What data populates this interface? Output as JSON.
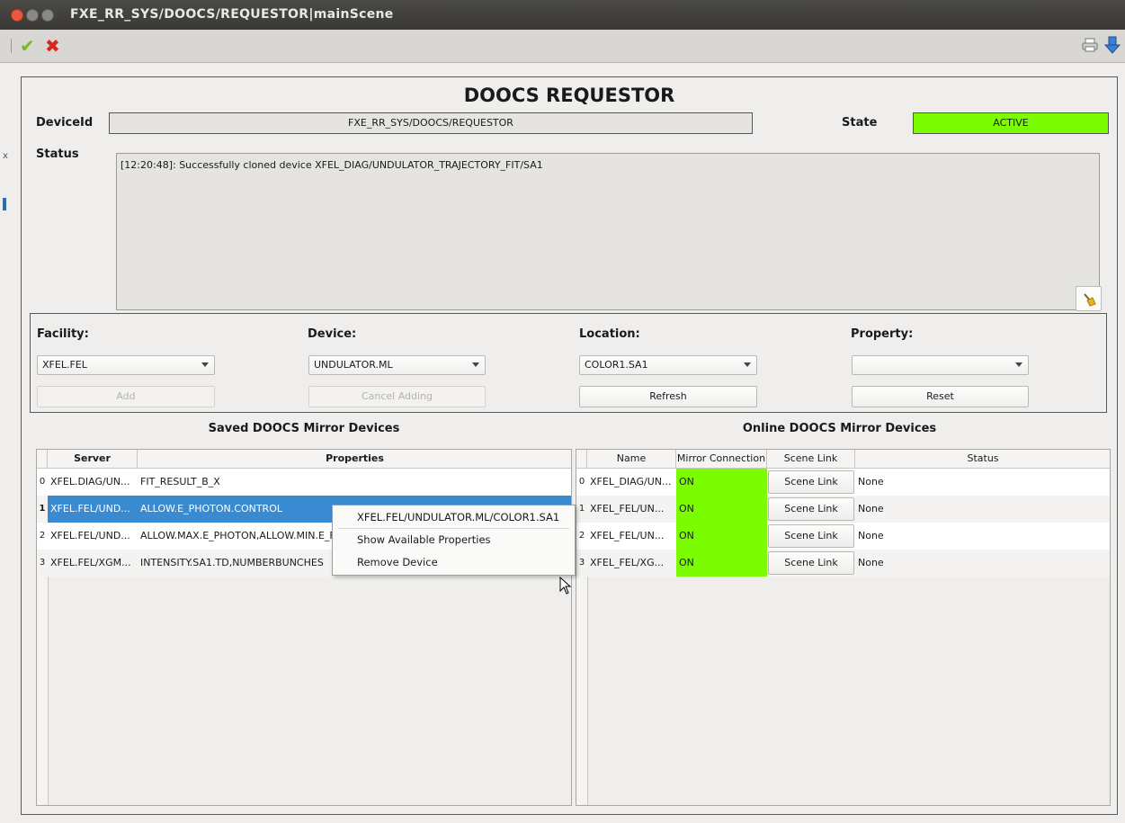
{
  "window": {
    "title": "FXE_RR_SYS/DOOCS/REQUESTOR|mainScene"
  },
  "toolbar": {
    "apply_icon": "checkmark-icon",
    "cancel_icon": "red-x-icon",
    "print_icon": "printer-icon",
    "download_icon": "blue-down-arrow-icon"
  },
  "scene": {
    "heading": "DOOCS REQUESTOR",
    "device_id_label": "DeviceId",
    "device_id_value": "FXE_RR_SYS/DOOCS/REQUESTOR",
    "state_label": "State",
    "state_value": "ACTIVE",
    "status_label": "Status",
    "status_text": "[12:20:48]: Successfully cloned device XFEL_DIAG/UNDULATOR_TRAJECTORY_FIT/SA1"
  },
  "selectors": {
    "facility": {
      "label": "Facility:",
      "value": "XFEL.FEL",
      "button": "Add"
    },
    "device": {
      "label": "Device:",
      "value": "UNDULATOR.ML",
      "button": "Cancel Adding"
    },
    "location": {
      "label": "Location:",
      "value": "COLOR1.SA1",
      "button": "Refresh"
    },
    "property": {
      "label": "Property:",
      "value": "",
      "button": "Reset"
    }
  },
  "saved": {
    "title": "Saved DOOCS Mirror Devices",
    "headers": [
      "Server",
      "Properties"
    ],
    "rows": [
      {
        "num": "0",
        "server": "XFEL.DIAG/UN...",
        "props": "FIT_RESULT_B_X"
      },
      {
        "num": "1",
        "server": "XFEL.FEL/UND...",
        "props": "ALLOW.E_PHOTON.CONTROL"
      },
      {
        "num": "2",
        "server": "XFEL.FEL/UND...",
        "props": "ALLOW.MAX.E_PHOTON,ALLOW.MIN.E_F"
      },
      {
        "num": "3",
        "server": "XFEL.FEL/XGM...",
        "props": "INTENSITY.SA1.TD,NUMBERBUNCHES"
      }
    ]
  },
  "online": {
    "title": "Online DOOCS Mirror Devices",
    "headers": [
      "Name",
      "Mirror Connection",
      "Scene Link",
      "Status"
    ],
    "rows": [
      {
        "num": "0",
        "name": "XFEL_DIAG/UN...",
        "conn": "ON",
        "link": "Scene Link",
        "status": "None"
      },
      {
        "num": "1",
        "name": "XFEL_FEL/UN...",
        "conn": "ON",
        "link": "Scene Link",
        "status": "None"
      },
      {
        "num": "2",
        "name": "XFEL_FEL/UN...",
        "conn": "ON",
        "link": "Scene Link",
        "status": "None"
      },
      {
        "num": "3",
        "name": "XFEL_FEL/XG...",
        "conn": "ON",
        "link": "Scene Link",
        "status": "None"
      }
    ]
  },
  "context_menu": {
    "items": [
      "XFEL.FEL/UNDULATOR.ML/COLOR1.SA1",
      "Show Available Properties",
      "Remove Device"
    ]
  },
  "colors": {
    "active_green": "#7cfc00",
    "selection_blue": "#3a8ad2",
    "title_bar": "#3c3b37"
  }
}
